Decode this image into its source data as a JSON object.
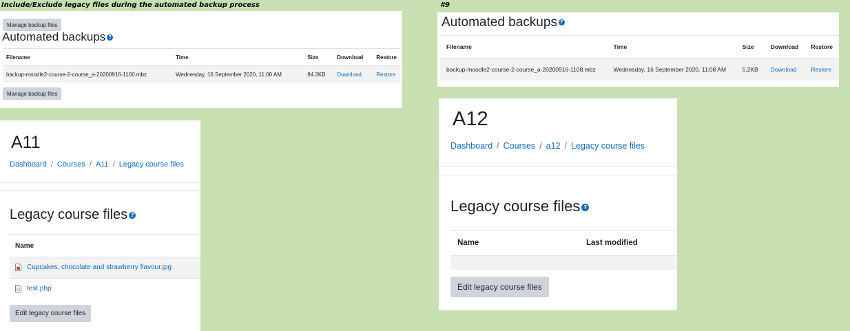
{
  "captions": {
    "left": "Include/Exclude legacy files during the automated backup process",
    "right": "#9"
  },
  "colors": {
    "background": "#c7dfb1",
    "link": "#0f6cbf",
    "button": "#ced4da",
    "help_icon": "#0f6cbf"
  },
  "backup_panel_left": {
    "manage_button": "Manage backup files",
    "title": "Automated backups",
    "help_icon": "?",
    "columns": [
      "Filename",
      "Time",
      "Size",
      "Download",
      "Restore"
    ],
    "rows": [
      {
        "filename": "backup-moodle2-course-2-course_a-20200916-1100.mbz",
        "time": "Wednesday, 16 September 2020, 11:00 AM",
        "size": "94.3KB",
        "download": "Download",
        "restore": "Restore"
      }
    ]
  },
  "backup_panel_right": {
    "title": "Automated backups",
    "help_icon": "?",
    "columns": [
      "Filename",
      "Time",
      "Size",
      "Download",
      "Restore"
    ],
    "rows": [
      {
        "filename": "backup-moodle2-course-2-course_a-20200916-1108.mbz",
        "time": "Wednesday, 16 September 2020, 11:08 AM",
        "size": "5.2KB",
        "download": "Download",
        "restore": "Restore"
      }
    ]
  },
  "legacy_panel_left": {
    "course_title": "A11",
    "breadcrumb": [
      "Dashboard",
      "Courses",
      "A11",
      "Legacy course files"
    ],
    "breadcrumb_separator": "/",
    "heading": "Legacy course files",
    "help_icon": "?",
    "columns": [
      "Name"
    ],
    "files": [
      {
        "name": "Cupcakes, chocolate and strawberry flavour.jpg",
        "icon": "image-file-icon"
      },
      {
        "name": "test.php",
        "icon": "generic-file-icon"
      }
    ],
    "edit_button": "Edit legacy course files"
  },
  "legacy_panel_right": {
    "course_title": "A12",
    "breadcrumb": [
      "Dashboard",
      "Courses",
      "a12",
      "Legacy course files"
    ],
    "breadcrumb_separator": "/",
    "heading": "Legacy course files",
    "help_icon": "?",
    "columns": [
      "Name",
      "Last modified"
    ],
    "edit_button": "Edit legacy course files"
  }
}
